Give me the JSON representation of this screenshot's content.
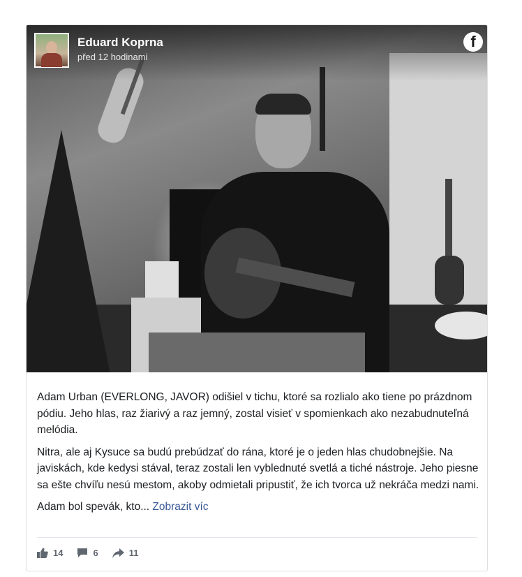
{
  "post": {
    "author": "Eduard Koprna",
    "time": "před 12 hodinami",
    "platform_icon": "facebook-icon",
    "paragraphs": [
      "Adam Urban (EVERLONG, JAVOR) odišiel v tichu, ktoré sa rozlialo ako tiene po prázdnom pódiu. Jeho hlas, raz žiarivý a raz jemný, zostal visieť v spomienkach ako nezabudnuteľná melódia.",
      "Nitra, ale aj Kysuce sa budú prebúdzať do rána, ktoré je o jeden hlas chudobnejšie. Na javiskách, kde kedysi stával, teraz zostali len vyblednuté svetlá a tiché nástroje. Jeho piesne sa ešte chvíľu nesú mestom, akoby odmietali pripustiť, že ich tvorca už nekráča medzi nami."
    ],
    "truncated_text": "Adam bol spevák, kto... ",
    "more_link": "Zobrazit víc"
  },
  "stats": {
    "likes": "14",
    "comments": "6",
    "shares": "11"
  },
  "colors": {
    "link": "#385898",
    "muted": "#606770",
    "text": "#1c1e21"
  }
}
